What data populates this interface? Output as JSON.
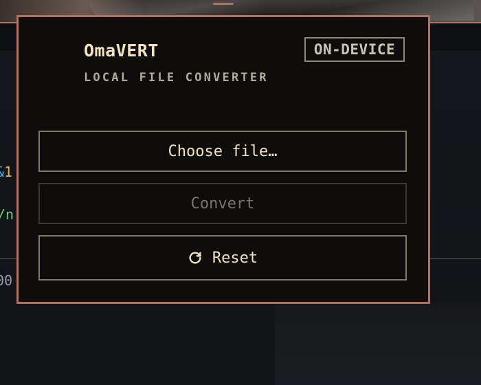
{
  "app": {
    "title": "OmaVERT",
    "subtitle": "LOCAL FILE CONVERTER",
    "badge": "ON-DEVICE"
  },
  "actions": {
    "choose_label": "Choose file…",
    "convert_label": "Convert",
    "convert_disabled": true,
    "reset_label": "Reset",
    "reset_icon": "refresh-icon"
  },
  "background": {
    "line_1a": "&",
    "line_1b": "1",
    "line_2": "/n",
    "line_3": "00"
  },
  "colors": {
    "accent_border": "#b07362",
    "text_primary": "#f2e3bd",
    "text_muted": "#b3ac9c",
    "button_border": "#7e7d68",
    "modal_bg": "#0e0d0b"
  }
}
